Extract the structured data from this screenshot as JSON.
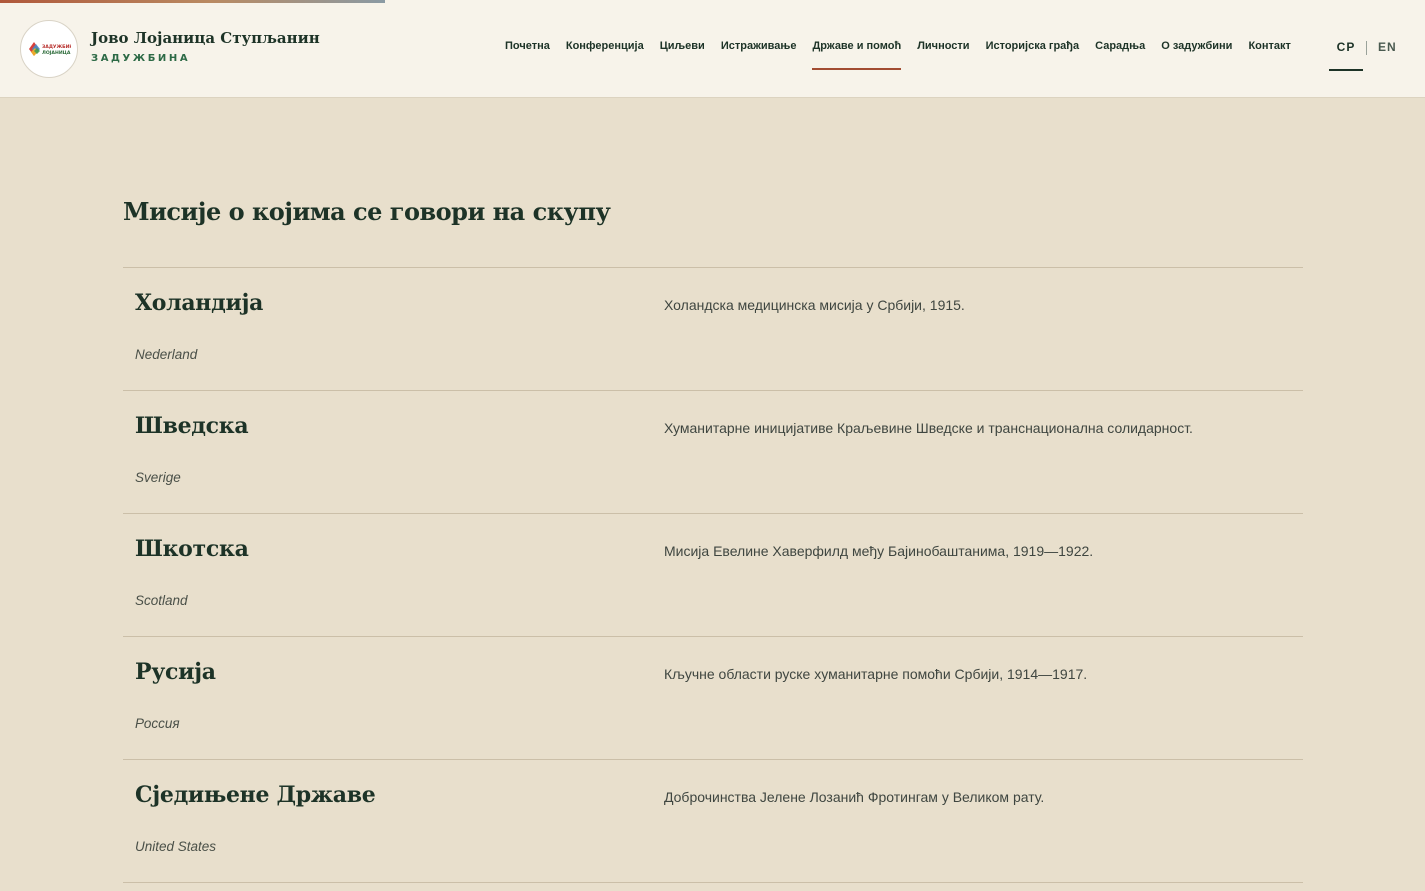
{
  "header": {
    "brand_title": "Јово Лојаница Ступљанин",
    "brand_subtitle": "ЗАДУЖБИНА",
    "logo_text": [
      "ЗАДУЖБИНА",
      "ЛОЈАНИЦА"
    ],
    "nav": [
      {
        "label": "Почетна",
        "active": false
      },
      {
        "label": "Конференција",
        "active": false
      },
      {
        "label": "Циљеви",
        "active": false
      },
      {
        "label": "Истраживање",
        "active": false
      },
      {
        "label": "Државе и помоћ",
        "active": true
      },
      {
        "label": "Личности",
        "active": false
      },
      {
        "label": "Историјска грађа",
        "active": false
      },
      {
        "label": "Сарадња",
        "active": false
      },
      {
        "label": "О задужбини",
        "active": false
      },
      {
        "label": "Контакт",
        "active": false
      }
    ],
    "languages": {
      "current": "СР",
      "other": "EN"
    }
  },
  "main": {
    "section_title": "Мисије о којима се говори на скупу",
    "missions": [
      {
        "name": "Холандија",
        "native": "Nederland",
        "description": "Холандска медицинска мисија у Србији, 1915."
      },
      {
        "name": "Шведска",
        "native": "Sverige",
        "description": "Хуманитарне иницијативе Краљевине Шведске и транснационална солидарност."
      },
      {
        "name": "Шкотска",
        "native": "Scotland",
        "description": "Мисија Евелине Хаверфилд међу Бајинобаштанима, 1919—1922."
      },
      {
        "name": "Русија",
        "native": "Россия",
        "description": "Кључне области руске хуманитарне помоћи Србији, 1914—1917."
      },
      {
        "name": "Сједињене Државе",
        "native": "United States",
        "description": "Доброчинства Јелене Лозанић Фротингам у Великом рату."
      }
    ]
  },
  "colors": {
    "background": "#e8dfcc",
    "header_bg": "#f7f3ea",
    "text_dark_green": "#1d3327",
    "accent_green": "#2d6a46",
    "active_underline": "#a24c32",
    "divider": "#cbbfa8"
  }
}
